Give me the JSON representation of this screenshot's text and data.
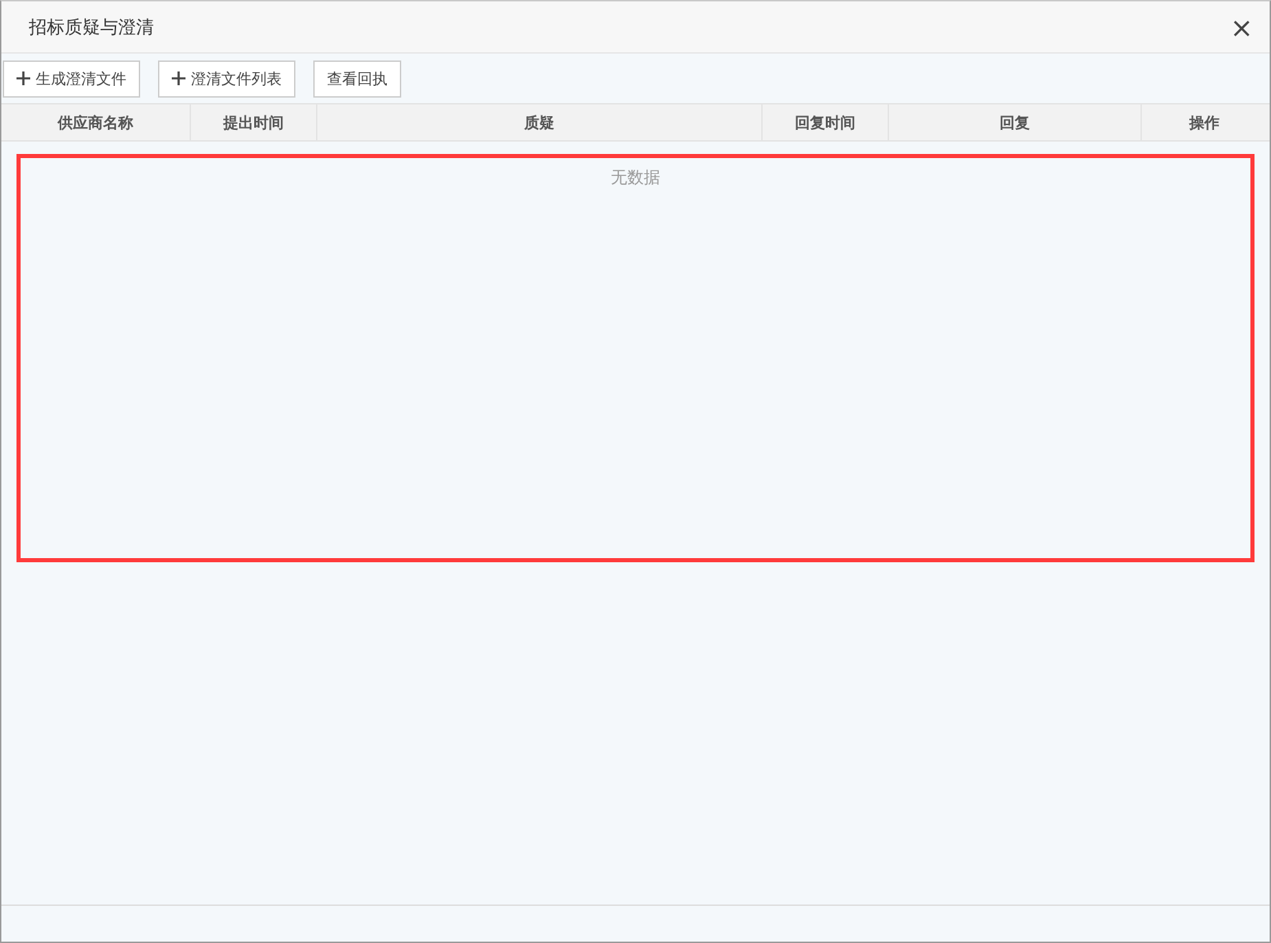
{
  "window": {
    "title": "招标质疑与澄清",
    "close": "×"
  },
  "toolbar": [
    {
      "label": "生成澄清文件",
      "kind": "add"
    },
    {
      "label": "澄清文件列表",
      "kind": "add"
    },
    {
      "label": "查看回执",
      "kind": "plain"
    }
  ],
  "table": {
    "columns": [
      "供应商名称",
      "提出时间",
      "质疑",
      "回复时间",
      "回复",
      "操作"
    ],
    "empty_text": "无数据"
  }
}
